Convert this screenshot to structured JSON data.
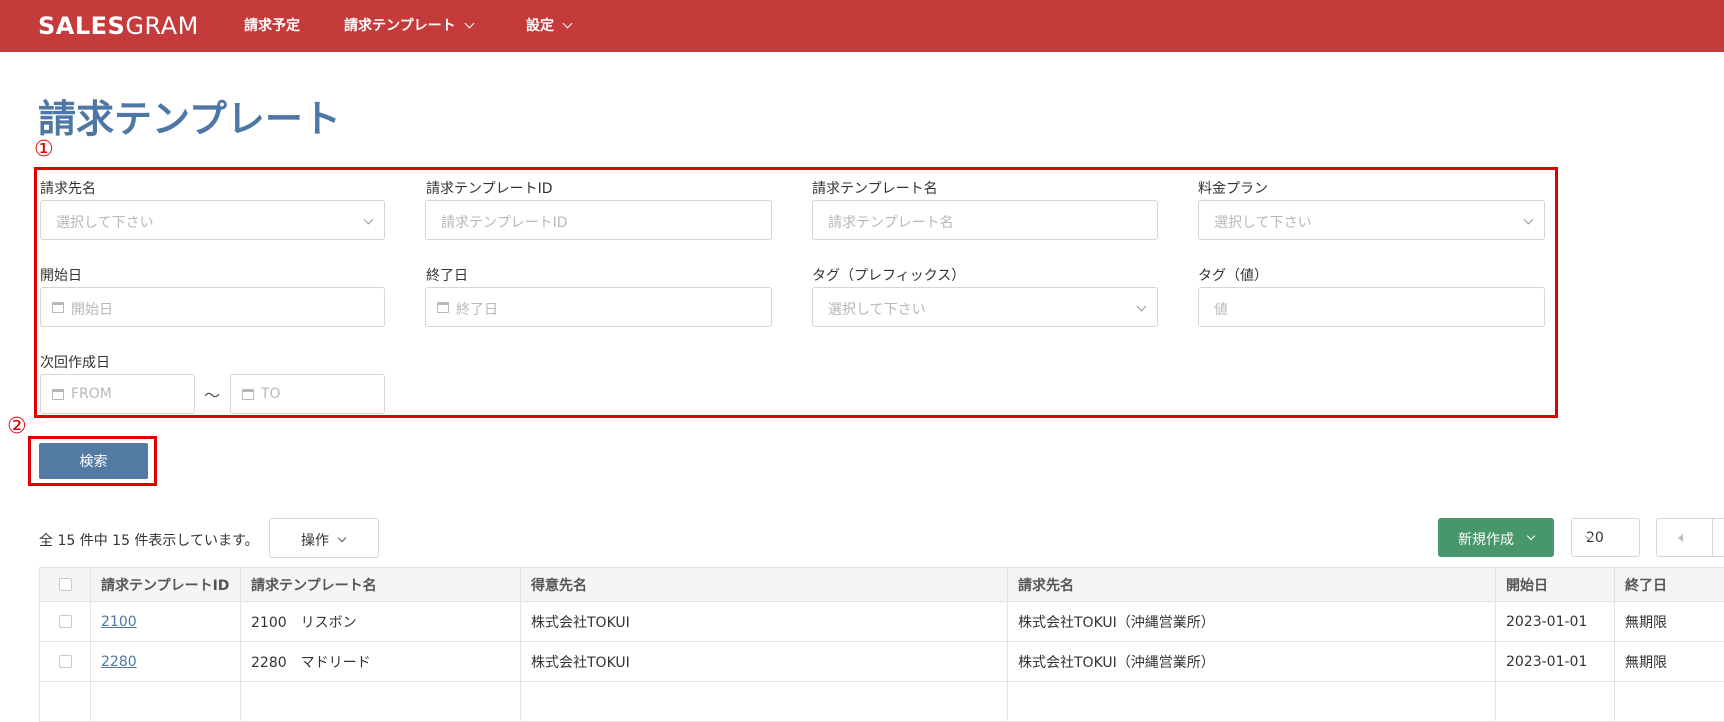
{
  "nav": {
    "logo_bold": "SALES",
    "logo_light": "GRAM",
    "items": [
      {
        "label": "請求予定"
      },
      {
        "label": "請求テンプレート"
      },
      {
        "label": "設定"
      }
    ]
  },
  "page": {
    "title": "請求テンプレート"
  },
  "markers": {
    "one": "①",
    "two": "②"
  },
  "filters": {
    "billing_name": {
      "label": "請求先名",
      "placeholder": "選択して下さい"
    },
    "template_id": {
      "label": "請求テンプレートID",
      "placeholder": "請求テンプレートID"
    },
    "template_name": {
      "label": "請求テンプレート名",
      "placeholder": "請求テンプレート名"
    },
    "plan": {
      "label": "料金プラン",
      "placeholder": "選択して下さい"
    },
    "start_date": {
      "label": "開始日",
      "placeholder": "開始日"
    },
    "end_date": {
      "label": "終了日",
      "placeholder": "終了日"
    },
    "tag_prefix": {
      "label": "タグ（プレフィックス）",
      "placeholder": "選択して下さい"
    },
    "tag_value": {
      "label": "タグ（値）",
      "placeholder": "値"
    },
    "next_date": {
      "label": "次回作成日",
      "from_placeholder": "FROM",
      "to_placeholder": "TO",
      "separator": "〜"
    }
  },
  "search_button": "検索",
  "toolbar": {
    "count_text": "全 15 件中 15 件表示しています。",
    "operations_label": "操作",
    "new_label": "新規作成",
    "per_page": "20"
  },
  "table": {
    "headers": [
      "請求テンプレートID",
      "請求テンプレート名",
      "得意先名",
      "請求先名",
      "開始日",
      "終了日"
    ],
    "rows": [
      {
        "id": "2100",
        "name": "2100　リスボン",
        "customer": "株式会社TOKUI",
        "billing": "株式会社TOKUI（沖縄営業所）",
        "start": "2023-01-01",
        "end": "無期限"
      },
      {
        "id": "2280",
        "name": "2280　マドリード",
        "customer": "株式会社TOKUI",
        "billing": "株式会社TOKUI（沖縄営業所）",
        "start": "2023-01-01",
        "end": "無期限"
      }
    ]
  },
  "colors": {
    "nav_bg": "#c53a3a",
    "title": "#4f77a5",
    "primary_button": "#527aa3",
    "new_button": "#47976a",
    "highlight": "#e00000"
  }
}
